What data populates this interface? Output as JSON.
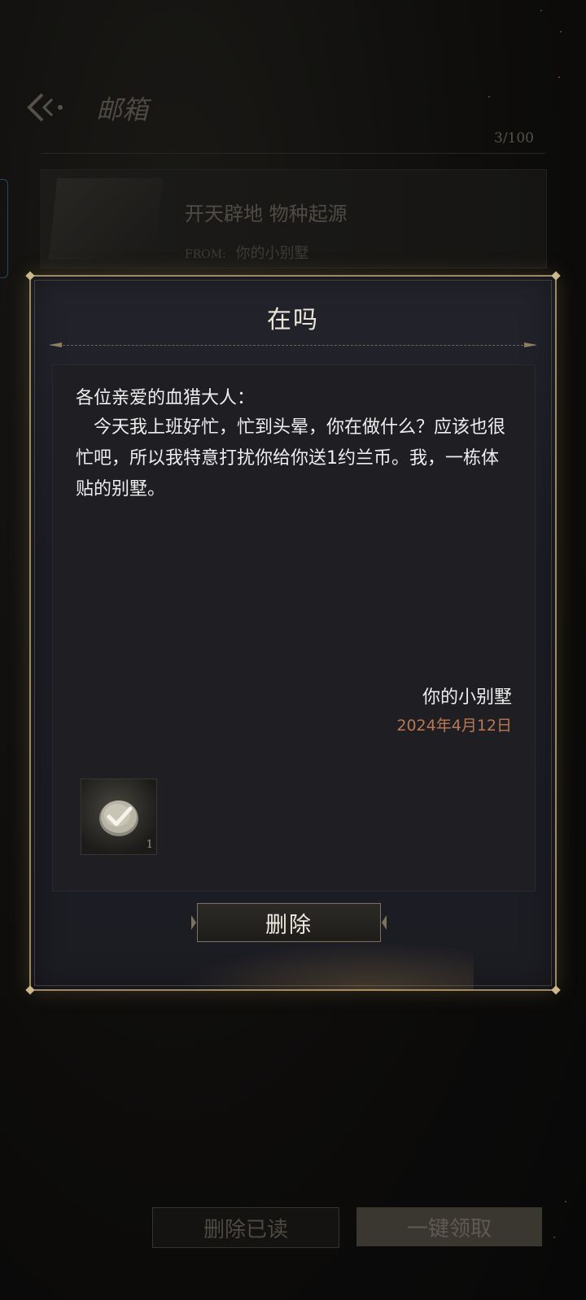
{
  "background": {
    "page_title": "邮箱",
    "mail_count": "3/100",
    "mail_item": {
      "title": "开天辟地 物种起源",
      "from_label": "FROM:",
      "from_name": "你的小别墅"
    },
    "buttons": {
      "delete_read": "删除已读",
      "claim_all": "一键领取"
    }
  },
  "modal": {
    "title": "在吗",
    "greeting": "各位亲爱的血猎大人：",
    "body": "今天我上班好忙，忙到头晕，你在做什么？应该也很忙吧，所以我特意打扰你给你送1约兰币。我，一栋体贴的别墅。",
    "signature": "你的小别墅",
    "date": "2024年4月12日",
    "reward": {
      "icon": "check-coin-icon",
      "count": "1"
    },
    "delete_button": "删除"
  },
  "colors": {
    "modal_border": "#9c8a66",
    "date_color": "#b97855",
    "text": "#eeeeee"
  }
}
